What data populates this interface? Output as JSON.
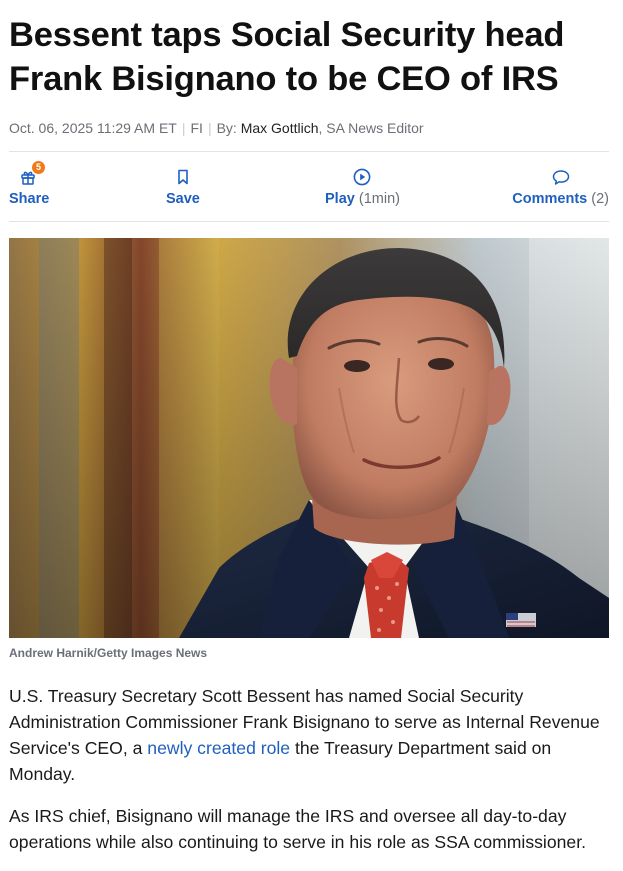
{
  "article": {
    "headline": "Bessent taps Social Security head Frank Bisignano to be CEO of IRS",
    "byline": {
      "date": "Oct. 06, 2025 11:29 AM ET",
      "ticker": "FI",
      "by_label": "By:",
      "author": "Max Gottlich",
      "author_role": ", SA News Editor"
    },
    "actions": {
      "share": {
        "label": "Share",
        "badge": "5",
        "icon": "gift-icon"
      },
      "save": {
        "label": "Save",
        "icon": "bookmark-icon"
      },
      "play": {
        "label": "Play",
        "duration": "(1min)",
        "icon": "play-circle-icon"
      },
      "comments": {
        "label": "Comments",
        "count": "(2)",
        "icon": "comment-bubble-icon"
      }
    },
    "image": {
      "caption": "Andrew Harnik/Getty Images News"
    },
    "paragraphs": {
      "p1_before": "U.S. Treasury Secretary Scott Bessent has named Social Security Administration Commissioner Frank Bisignano to serve as Internal Revenue Service's CEO, a ",
      "p1_link": "newly created role",
      "p1_after": " the Treasury Department said on Monday.",
      "p2": "As IRS chief, Bisignano will manage the IRS and oversee all day-to-day operations while also continuing to serve in his role as SSA commissioner."
    },
    "colors": {
      "link": "#1f5fbf",
      "badge": "#f07a18",
      "muted": "#6b6f76"
    }
  }
}
